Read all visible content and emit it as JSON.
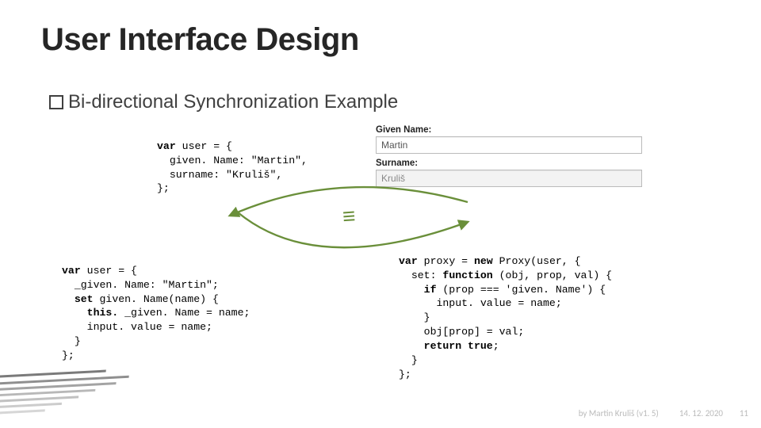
{
  "title": "User Interface Design",
  "bullet": {
    "label_prefix": "Bi-directional",
    "label_rest": " Synchronization Example"
  },
  "code1": {
    "l1_kw": "var",
    "l1_rest": " user = {",
    "l2": "  given. Name: \"Martin\",",
    "l3": "  surname: \"Kruliš\",",
    "l4": "};"
  },
  "code2": {
    "l1_kw": "var",
    "l1_rest": " user = {",
    "l2": "  _given. Name: \"Martin\";",
    "l3a_kw": "  set",
    "l3a_rest": " given. Name(name) {",
    "l4a_kw": "    this.",
    "l4a_rest": " _given. Name = name;",
    "l5": "    input. value = name;",
    "l6": "  }",
    "l7": "};"
  },
  "code3": {
    "l1_kw": "var",
    "l1_mid": " proxy = ",
    "l1_kw2": "new",
    "l1_rest": " Proxy(user, {",
    "l2a": "  set: ",
    "l2b_kw": "function",
    "l2c": " (obj, prop, val) {",
    "l3a_kw": "    if",
    "l3b": " (prop === 'given. Name') {",
    "l4": "      input. value = name;",
    "l5": "    }",
    "l6": "    obj[prop] = val;",
    "l7a_kw": "    return true",
    "l7b": ";",
    "l8": "  }",
    "l9": "};"
  },
  "form": {
    "given_label": "Given Name:",
    "given_value": "Martin",
    "surname_label": "Surname:",
    "surname_value": "Kruliš"
  },
  "footer": {
    "author": "by Martin Kruliš (v1. 5)",
    "date": "14. 12. 2020",
    "page": "11"
  }
}
